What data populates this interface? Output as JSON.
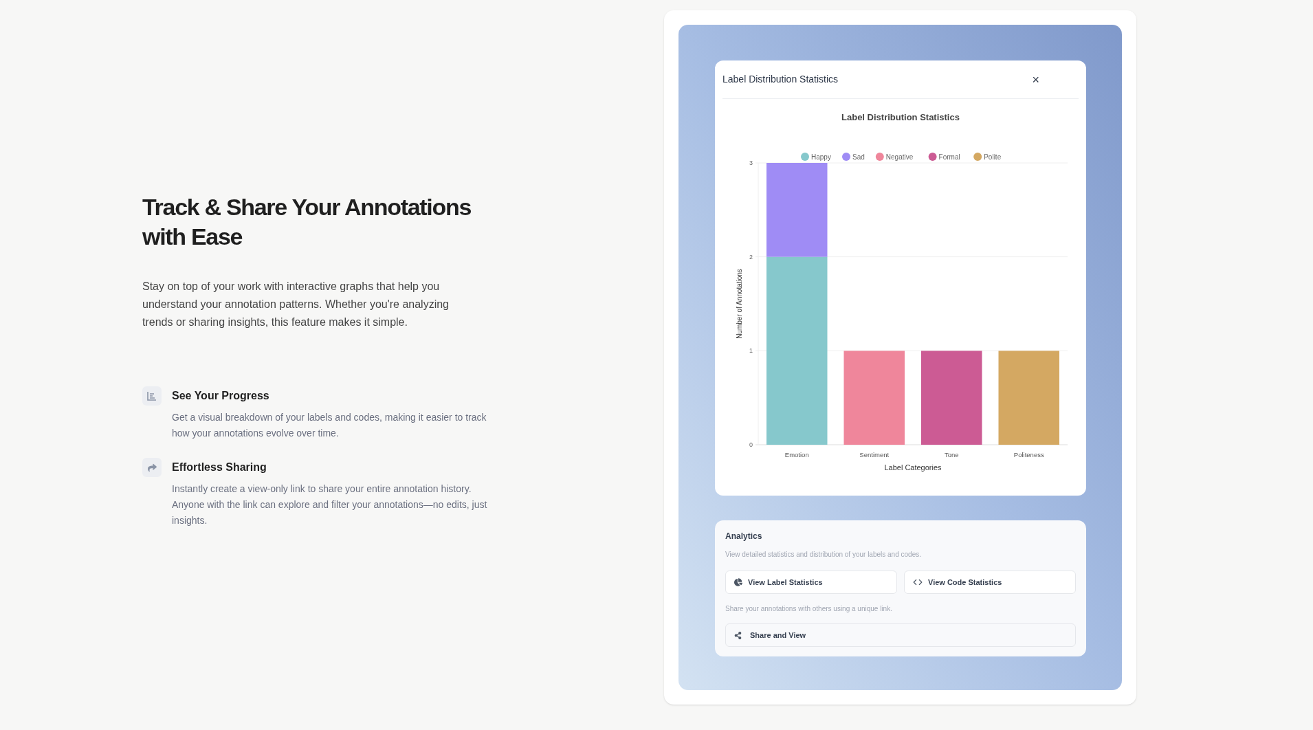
{
  "hero": {
    "title": "Track & Share Your Annotations with Ease",
    "description": "Stay on top of your work with interactive graphs that help you understand your annotation patterns. Whether you're analyzing trends or sharing insights, this feature makes it simple."
  },
  "features": [
    {
      "kind": "chart",
      "title": "See Your Progress",
      "text": "Get a visual breakdown of your labels and codes, making it easier to track how your annotations evolve over time."
    },
    {
      "kind": "share",
      "title": "Effortless Sharing",
      "text": "Instantly create a view-only link to share your entire annotation history. Anyone with the link can explore and filter your annotations—no edits, just insights."
    }
  ],
  "modal": {
    "title": "Label Distribution Statistics",
    "close": "×",
    "chart_data": {
      "type": "bar",
      "title": "Label Distribution Statistics",
      "xlabel": "Label Categories",
      "ylabel": "Number of Annotations",
      "categories": [
        "Emotion",
        "Sentiment",
        "Tone",
        "Politeness"
      ],
      "stacked": true,
      "legend": "top",
      "ylim": [
        0,
        3
      ],
      "yticks": [
        0,
        1,
        2,
        3
      ],
      "series": [
        {
          "name": "Happy",
          "color": "#86c8cc",
          "values": [
            2,
            0,
            0,
            0
          ]
        },
        {
          "name": "Sad",
          "color": "#9f8cf5",
          "values": [
            1,
            0,
            0,
            0
          ]
        },
        {
          "name": "Negative",
          "color": "#ef869b",
          "values": [
            0,
            1,
            0,
            0
          ]
        },
        {
          "name": "Formal",
          "color": "#cc5b94",
          "values": [
            0,
            0,
            1,
            0
          ]
        },
        {
          "name": "Polite",
          "color": "#d4a862",
          "values": [
            0,
            0,
            0,
            1
          ]
        }
      ]
    }
  },
  "analytics": {
    "title": "Analytics",
    "description": "View detailed statistics and distribution of your labels and codes.",
    "buttons": [
      {
        "kind": "pie",
        "label": "View Label Statistics"
      },
      {
        "kind": "code",
        "label": "View Code Statistics"
      }
    ],
    "share_description": "Share your annotations with others using a unique link.",
    "share_button": {
      "label": "Share and View"
    }
  }
}
